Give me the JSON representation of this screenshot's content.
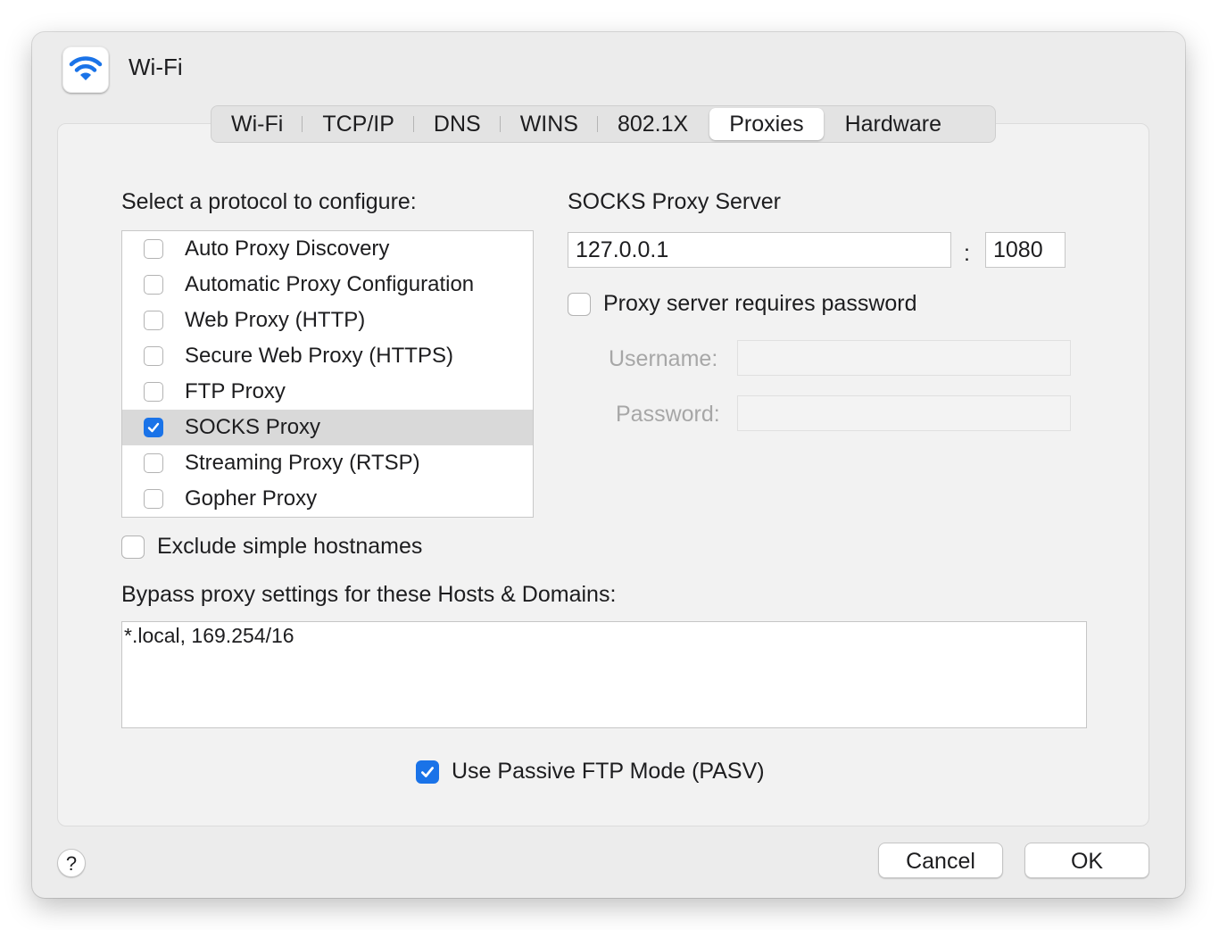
{
  "window": {
    "title": "Wi-Fi",
    "app_icon": "wifi-icon",
    "accent_color": "#1a73e8"
  },
  "tabs": [
    {
      "label": "Wi-Fi",
      "active": false
    },
    {
      "label": "TCP/IP",
      "active": false
    },
    {
      "label": "DNS",
      "active": false
    },
    {
      "label": "WINS",
      "active": false
    },
    {
      "label": "802.1X",
      "active": false
    },
    {
      "label": "Proxies",
      "active": true
    },
    {
      "label": "Hardware",
      "active": false
    }
  ],
  "protocols": {
    "heading": "Select a protocol to configure:",
    "items": [
      {
        "label": "Auto Proxy Discovery",
        "checked": false,
        "selected": false
      },
      {
        "label": "Automatic Proxy Configuration",
        "checked": false,
        "selected": false
      },
      {
        "label": "Web Proxy (HTTP)",
        "checked": false,
        "selected": false
      },
      {
        "label": "Secure Web Proxy (HTTPS)",
        "checked": false,
        "selected": false
      },
      {
        "label": "FTP Proxy",
        "checked": false,
        "selected": false
      },
      {
        "label": "SOCKS Proxy",
        "checked": true,
        "selected": true
      },
      {
        "label": "Streaming Proxy (RTSP)",
        "checked": false,
        "selected": false
      },
      {
        "label": "Gopher Proxy",
        "checked": false,
        "selected": false
      }
    ]
  },
  "server": {
    "heading": "SOCKS Proxy Server",
    "host": "127.0.0.1",
    "separator": ":",
    "port": "1080",
    "requires_password_label": "Proxy server requires password",
    "requires_password": false,
    "username_label": "Username:",
    "username_value": "",
    "password_label": "Password:",
    "password_value": ""
  },
  "exclude_simple": {
    "label": "Exclude simple hostnames",
    "checked": false
  },
  "bypass": {
    "label": "Bypass proxy settings for these Hosts & Domains:",
    "value": "*.local, 169.254/16"
  },
  "passive_ftp": {
    "label": "Use Passive FTP Mode (PASV)",
    "checked": true
  },
  "footer": {
    "help_label": "?",
    "cancel_label": "Cancel",
    "ok_label": "OK"
  }
}
